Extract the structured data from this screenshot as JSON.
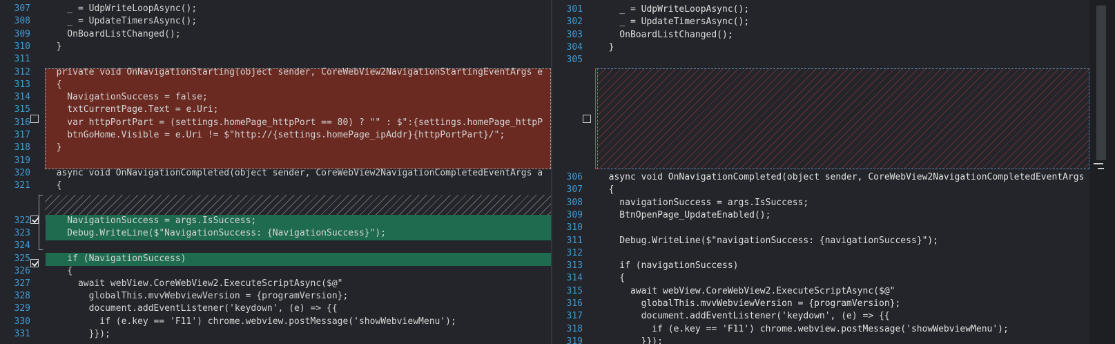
{
  "left": {
    "lines": [
      {
        "n": "307",
        "code": "    _ = UdpWriteLoopAsync();"
      },
      {
        "n": "308",
        "code": "    _ = UpdateTimersAsync();"
      },
      {
        "n": "309",
        "code": "    OnBoardListChanged();"
      },
      {
        "n": "310",
        "code": "  }"
      },
      {
        "n": "311",
        "code": ""
      },
      {
        "n": "312",
        "code": "  private void OnNavigationStarting(object sender, CoreWebView2NavigationStartingEventArgs e"
      },
      {
        "n": "313",
        "code": "  {"
      },
      {
        "n": "314",
        "code": "    NavigationSuccess = false;"
      },
      {
        "n": "315",
        "code": "    txtCurrentPage.Text = e.Uri;"
      },
      {
        "n": "316",
        "code": "    var httpPortPart = (settings.homePage_httpPort == 80) ? \"\" : $\":{settings.homePage_httpP"
      },
      {
        "n": "317",
        "code": "    btnGoHome.Visible = e.Uri != $\"http://{settings.homePage_ipAddr}{httpPortPart}/\";"
      },
      {
        "n": "318",
        "code": "  }"
      },
      {
        "n": "319",
        "code": ""
      },
      {
        "n": "320",
        "code": "  async void OnNavigationCompleted(object sender, CoreWebView2NavigationCompletedEventArgs a"
      },
      {
        "n": "321",
        "code": "  {"
      },
      {
        "n": "322",
        "code": "    NavigationSuccess = args.IsSuccess;"
      },
      {
        "n": "323",
        "code": "    Debug.WriteLine($\"NavigationSuccess: {NavigationSuccess}\");"
      },
      {
        "n": "324",
        "code": ""
      },
      {
        "n": "325",
        "code": "    if (NavigationSuccess)"
      },
      {
        "n": "326",
        "code": "    {"
      },
      {
        "n": "327",
        "code": "      await webView.CoreWebView2.ExecuteScriptAsync($@\""
      },
      {
        "n": "328",
        "code": "        globalThis.mvvWebviewVersion = {programVersion};"
      },
      {
        "n": "329",
        "code": "        document.addEventListener('keydown', (e) => {{"
      },
      {
        "n": "330",
        "code": "          if (e.key == 'F11') chrome.webview.postMessage('showWebviewMenu');"
      },
      {
        "n": "331",
        "code": "        }});"
      }
    ]
  },
  "right": {
    "lines": [
      {
        "n": "301",
        "code": "    _ = UdpWriteLoopAsync();"
      },
      {
        "n": "302",
        "code": "    _ = UpdateTimersAsync();"
      },
      {
        "n": "303",
        "code": "    OnBoardListChanged();"
      },
      {
        "n": "304",
        "code": "  }"
      },
      {
        "n": "305",
        "code": ""
      },
      {
        "n": "306",
        "code": "  async void OnNavigationCompleted(object sender, CoreWebView2NavigationCompletedEventArgs"
      },
      {
        "n": "307",
        "code": "  {"
      },
      {
        "n": "308",
        "code": "    navigationSuccess = args.IsSuccess;"
      },
      {
        "n": "309",
        "code": "    BtnOpenPage_UpdateEnabled();"
      },
      {
        "n": "310",
        "code": ""
      },
      {
        "n": "311",
        "code": "    Debug.WriteLine($\"navigationSuccess: {navigationSuccess}\");"
      },
      {
        "n": "312",
        "code": ""
      },
      {
        "n": "313",
        "code": "    if (navigationSuccess)"
      },
      {
        "n": "314",
        "code": "    {"
      },
      {
        "n": "315",
        "code": "      await webView.CoreWebView2.ExecuteScriptAsync($@\""
      },
      {
        "n": "316",
        "code": "        globalThis.mvvWebviewVersion = {programVersion};"
      },
      {
        "n": "317",
        "code": "        document.addEventListener('keydown', (e) => {{"
      },
      {
        "n": "318",
        "code": "          if (e.key == 'F11') chrome.webview.postMessage('showWebviewMenu');"
      },
      {
        "n": "319",
        "code": "        }});"
      }
    ]
  },
  "checkboxes": {
    "deleted_block": false,
    "placeholder_block": false,
    "added_block": true,
    "added_line_325": true
  },
  "colors": {
    "deleted_bg": "#6a2a22",
    "added_bg": "#1e6b50",
    "line_number": "#3f9bd6"
  }
}
